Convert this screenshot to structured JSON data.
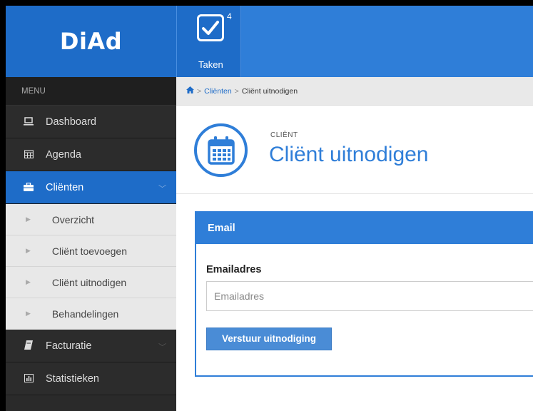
{
  "app": {
    "logo": "DiAd"
  },
  "header": {
    "tasks_label": "Taken",
    "tasks_count": "4"
  },
  "sidebar": {
    "menu_header": "MENU",
    "items": [
      {
        "label": "Dashboard",
        "icon": "laptop-icon"
      },
      {
        "label": "Agenda",
        "icon": "calendar-icon"
      },
      {
        "label": "Cliënten",
        "icon": "briefcase-icon",
        "active": true
      },
      {
        "label": "Facturatie",
        "icon": "book-icon"
      },
      {
        "label": "Statistieken",
        "icon": "bar-chart-icon"
      }
    ],
    "sub_items": [
      {
        "label": "Overzicht"
      },
      {
        "label": "Cliënt toevoegen"
      },
      {
        "label": "Cliënt uitnodigen"
      },
      {
        "label": "Behandelingen"
      }
    ]
  },
  "breadcrumb": {
    "level1": "Cliënten",
    "level2": "Cliënt uitnodigen"
  },
  "page": {
    "subtitle": "CLIËNT",
    "title": "Cliënt uitnodigen"
  },
  "panel": {
    "header": "Email",
    "field_label": "Emailadres",
    "field_placeholder": "Emailadres",
    "field_value": "",
    "submit_label": "Verstuur uitnodiging"
  },
  "colors": {
    "primary": "#2f7ed8",
    "primary_dark": "#1e6cc8",
    "sidebar_bg": "#2a2a2a",
    "submenu_bg": "#e8e8e8"
  }
}
